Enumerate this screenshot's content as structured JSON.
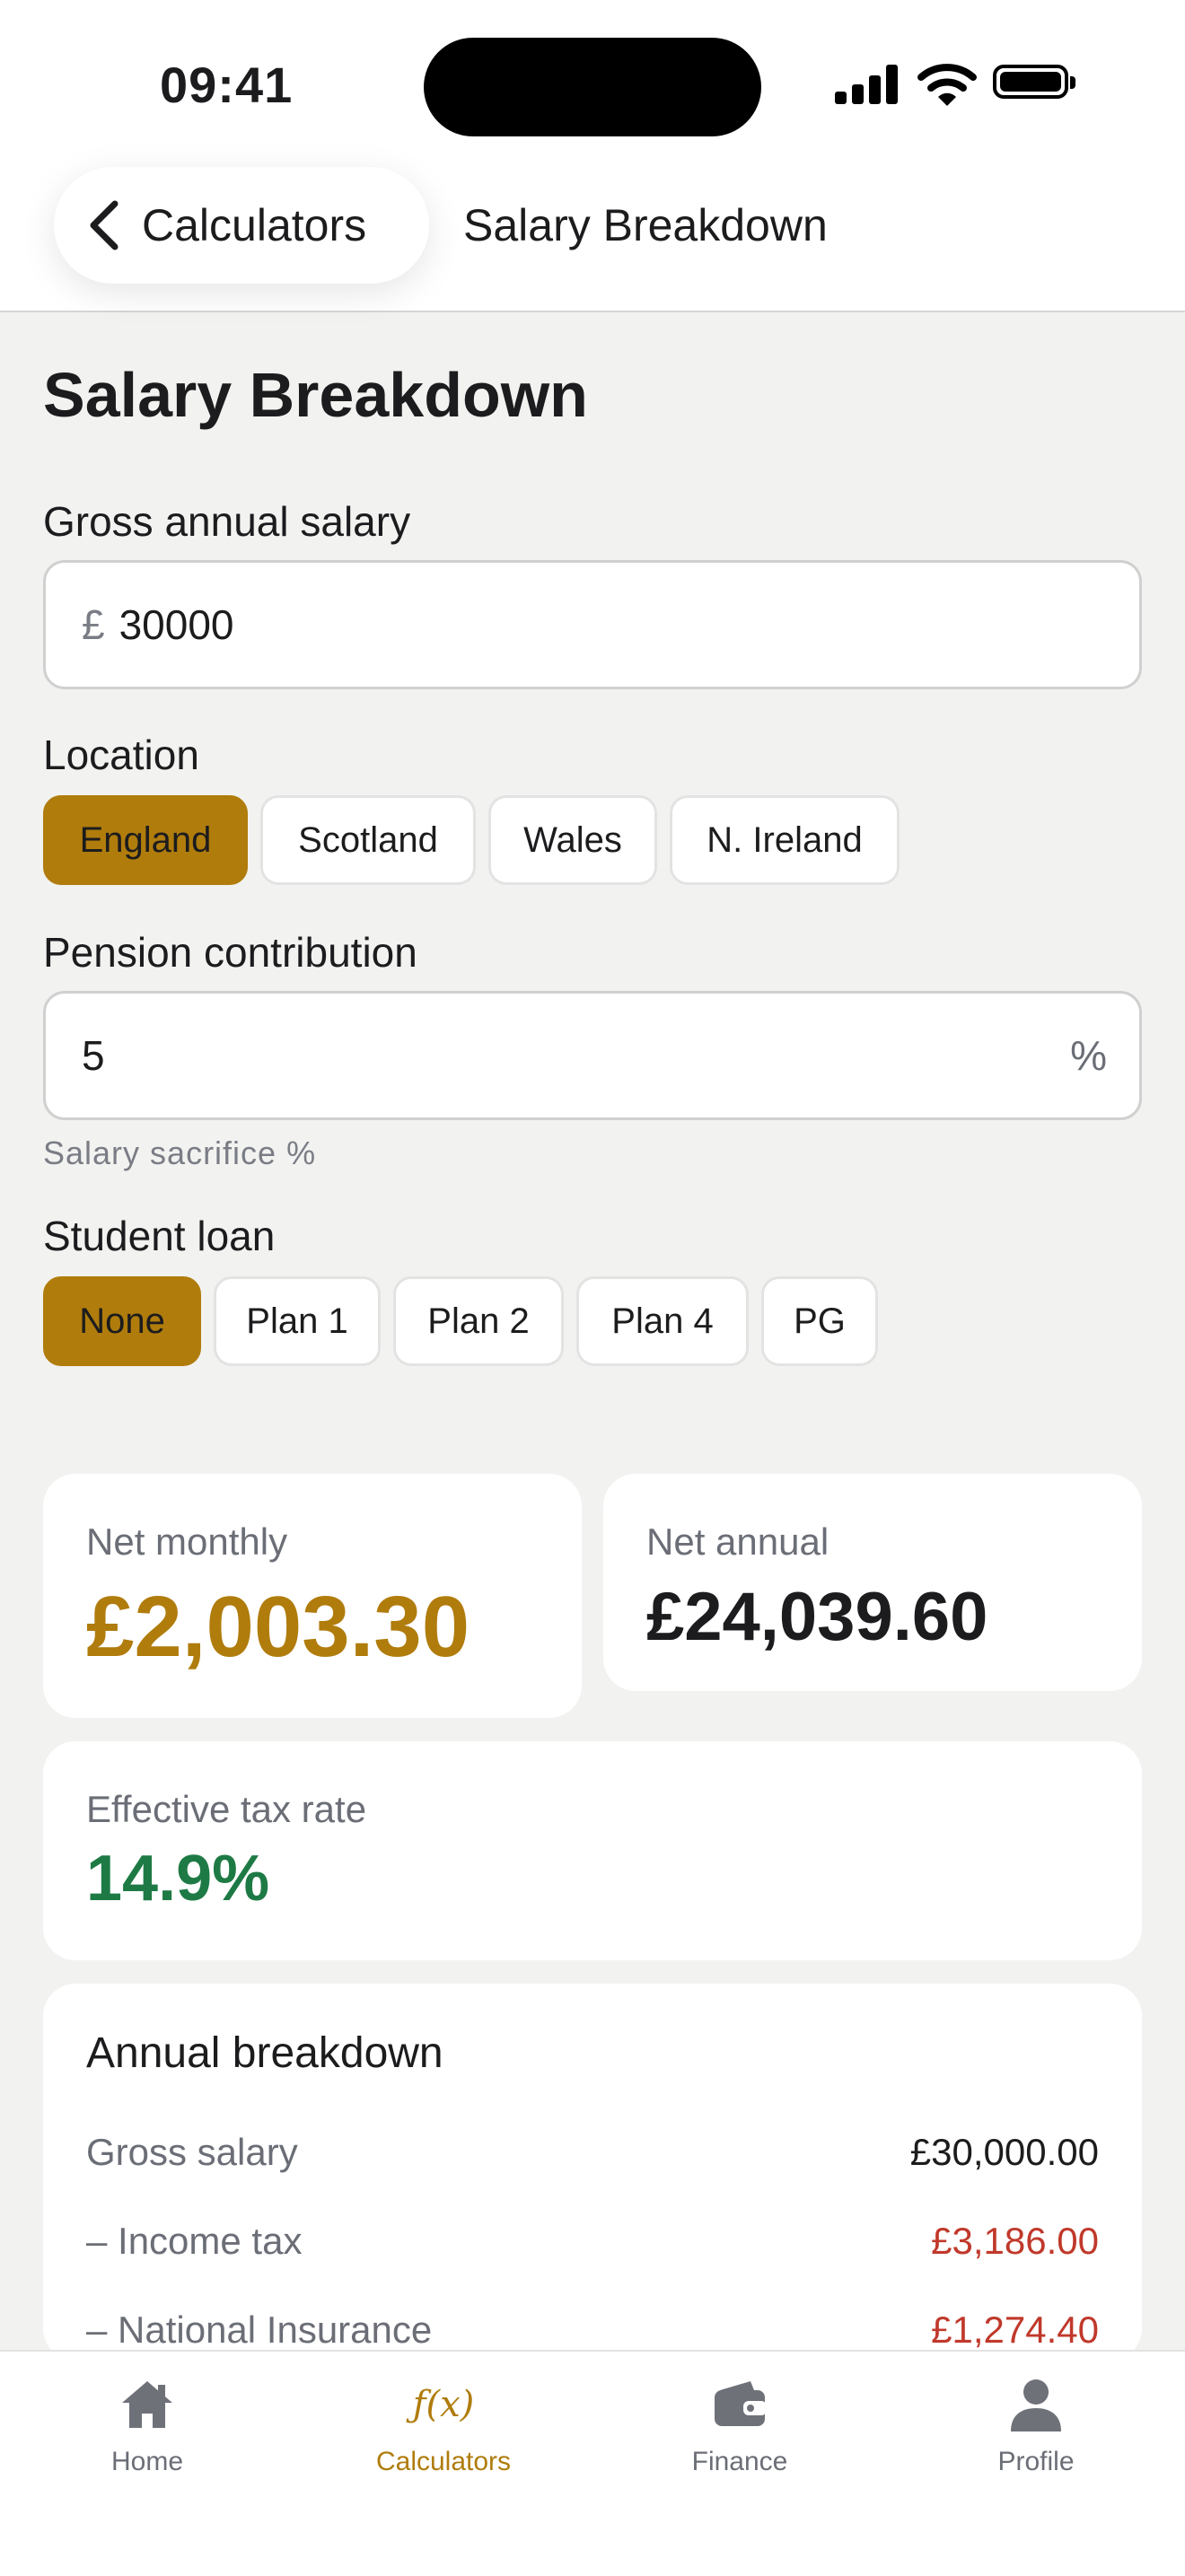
{
  "status_bar": {
    "time": "09:41"
  },
  "nav": {
    "back_label": "Calculators",
    "title": "Salary Breakdown"
  },
  "page": {
    "title": "Salary Breakdown"
  },
  "salary": {
    "label": "Gross annual salary",
    "currency_prefix": "£",
    "value": "30000"
  },
  "location": {
    "label": "Location",
    "options": [
      "England",
      "Scotland",
      "Wales",
      "N. Ireland"
    ],
    "selected": "England"
  },
  "pension": {
    "label": "Pension contribution",
    "value": "5",
    "suffix": "%",
    "hint": "Salary sacrifice %"
  },
  "student_loan": {
    "label": "Student loan",
    "options": [
      "None",
      "Plan 1",
      "Plan 2",
      "Plan 4",
      "PG"
    ],
    "selected": "None"
  },
  "results": {
    "net_monthly_label": "Net monthly",
    "net_monthly_value": "£2,003.30",
    "net_annual_label": "Net annual",
    "net_annual_value": "£24,039.60",
    "tax_rate_label": "Effective tax rate",
    "tax_rate_value": "14.9%"
  },
  "breakdown": {
    "title": "Annual breakdown",
    "rows": [
      {
        "label": "Gross salary",
        "value": "£30,000.00",
        "negative": false
      },
      {
        "label": "– Income tax",
        "value": "£3,186.00",
        "negative": true
      },
      {
        "label": "– National Insurance",
        "value": "£1,274.40",
        "negative": true
      }
    ]
  },
  "tabs": [
    {
      "label": "Home",
      "icon": "house-icon",
      "active": false
    },
    {
      "label": "Calculators",
      "icon": "function-icon",
      "glyph": "ƒ(x)",
      "active": true
    },
    {
      "label": "Finance",
      "icon": "wallet-icon",
      "active": false
    },
    {
      "label": "Profile",
      "icon": "person-icon",
      "active": false
    }
  ],
  "colors": {
    "accent": "#b07c0c",
    "positive": "#1e7a45",
    "negative": "#c0392b",
    "background": "#f2f2f0"
  }
}
